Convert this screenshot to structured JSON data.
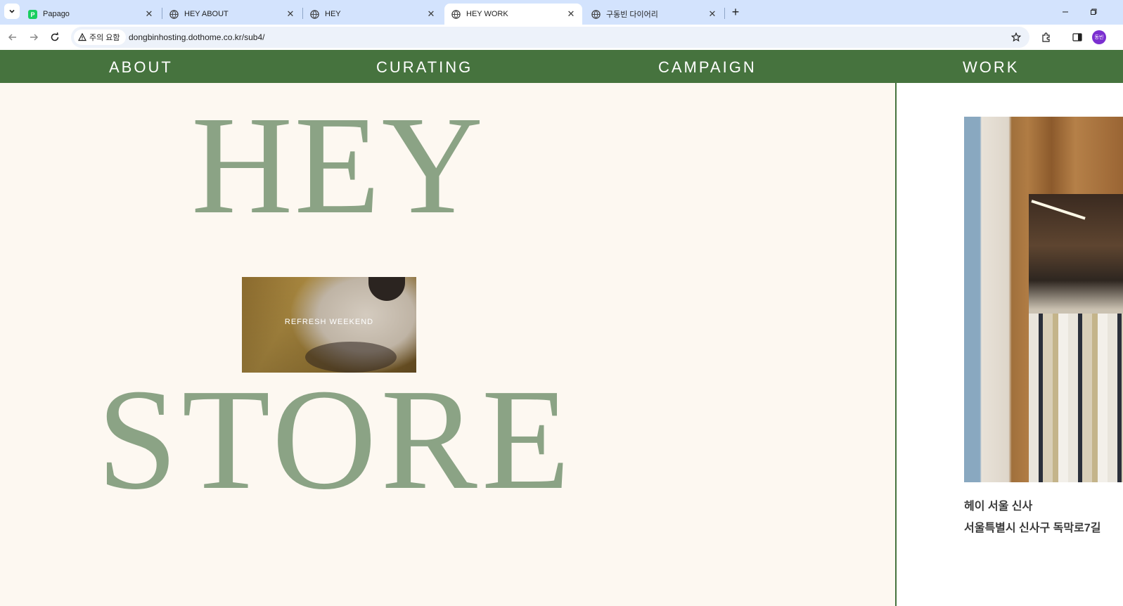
{
  "browser": {
    "tabs": [
      {
        "title": "Papago",
        "icon": "papago-icon",
        "active": false
      },
      {
        "title": "HEY ABOUT",
        "icon": "globe-icon",
        "active": false
      },
      {
        "title": "HEY",
        "icon": "globe-icon",
        "active": false
      },
      {
        "title": "HEY WORK",
        "icon": "globe-icon",
        "active": true
      },
      {
        "title": "구동빈 다이어리",
        "icon": "globe-icon",
        "active": false
      }
    ],
    "security_label": "주의 요함",
    "url": "dongbinhosting.dothome.co.kr/sub4/",
    "profile_initials": "동빈"
  },
  "nav": {
    "items": [
      "ABOUT",
      "CURATING",
      "CAMPAIGN",
      "WORK"
    ]
  },
  "hero": {
    "word_top": "HEY",
    "word_bottom": "STORE",
    "promo_caption": "REFRESH WEEKEND"
  },
  "store": {
    "name": "헤이 서울 신사",
    "address": "서울특별시 신사구 독막로7길"
  },
  "colors": {
    "nav_bg": "#46733e",
    "hero_text": "#8ba385",
    "page_bg": "#fdf8f1",
    "tabbar_bg": "#d3e3fd"
  }
}
